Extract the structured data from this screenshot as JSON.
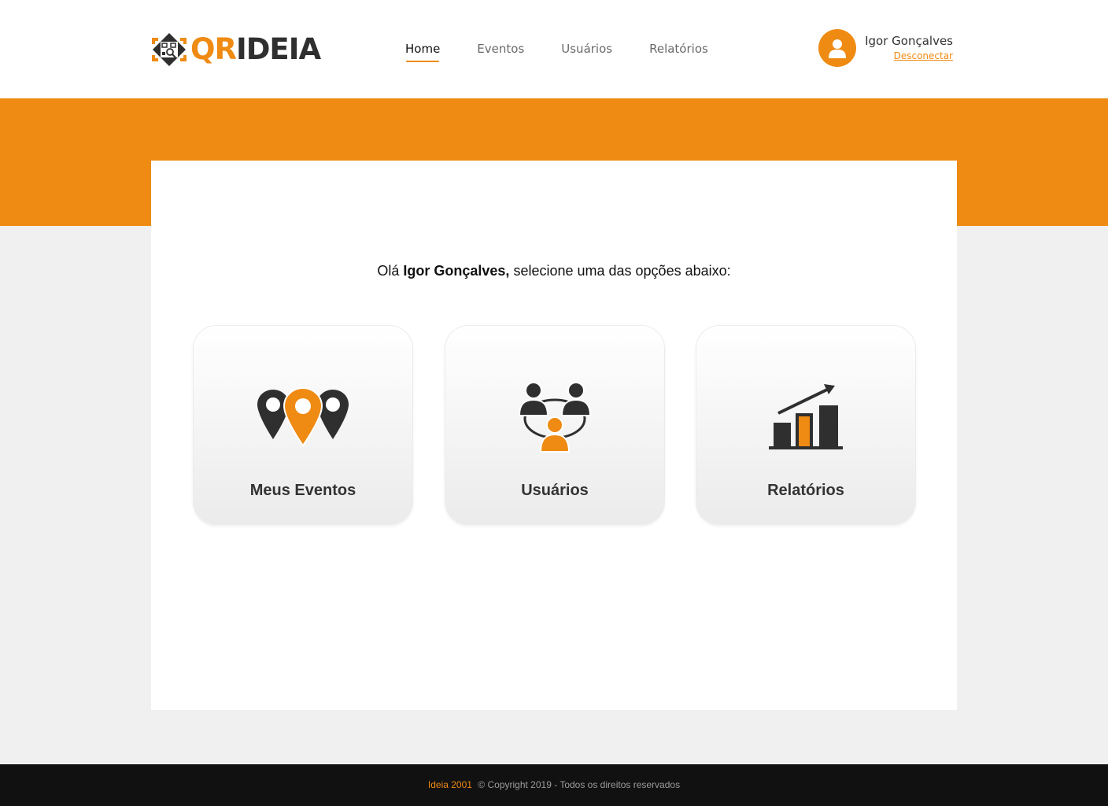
{
  "brand": {
    "logo_qr": "QR",
    "logo_ideia": "IDEIA",
    "accent_color": "#ef8a12"
  },
  "nav": {
    "items": [
      {
        "label": "Home",
        "active": true
      },
      {
        "label": "Eventos",
        "active": false
      },
      {
        "label": "Usuários",
        "active": false
      },
      {
        "label": "Relatórios",
        "active": false
      }
    ]
  },
  "user": {
    "name": "Igor Gonçalves",
    "logout_label": "Desconectar",
    "avatar_icon": "user-icon"
  },
  "main": {
    "greeting_prefix": "Olá ",
    "greeting_name": "Igor Gonçalves,",
    "greeting_suffix": " selecione uma das opções abaixo:",
    "cards": [
      {
        "label": "Meus Eventos",
        "icon": "map-pins-icon"
      },
      {
        "label": "Usuários",
        "icon": "users-network-icon"
      },
      {
        "label": "Relatórios",
        "icon": "bar-chart-growth-icon"
      }
    ]
  },
  "footer": {
    "brand": "Ideia 2001",
    "copyright": "© Copyright 2019 - Todos os direitos reservados"
  }
}
